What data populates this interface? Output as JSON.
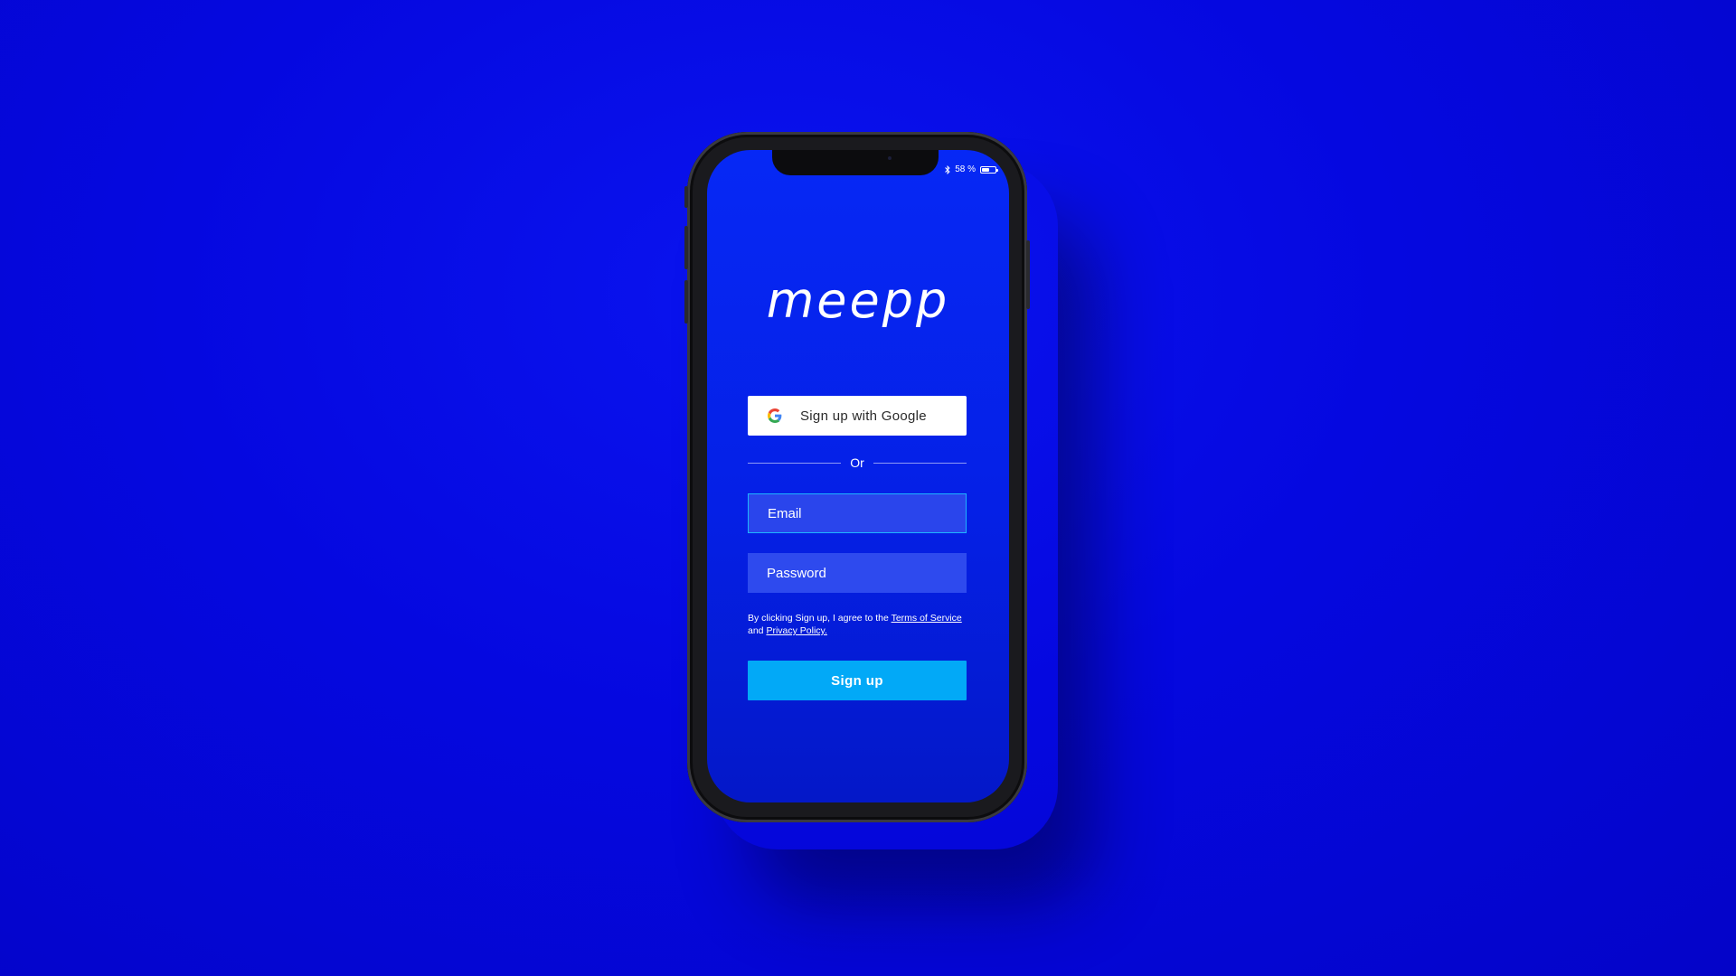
{
  "status_bar": {
    "battery_text": "58 %",
    "battery_level": 0.58
  },
  "app": {
    "logo": "meepp"
  },
  "google_button": {
    "label": "Sign up with Google",
    "icon": "google-icon"
  },
  "divider": {
    "label": "Or"
  },
  "email_field": {
    "placeholder": "Email"
  },
  "password_field": {
    "placeholder": "Password"
  },
  "terms": {
    "prefix": "By clicking Sign up, I agree to the ",
    "terms_link": "Terms of Service ",
    "conjunction": "and ",
    "privacy_link": "Privacy Policy."
  },
  "signup_button": {
    "label": "Sign up"
  },
  "colors": {
    "background": "#0508e0",
    "screen": "#0520e6",
    "field": "#2e4aee",
    "focus_border": "#1fb4ff",
    "primary_button": "#02a9f7"
  }
}
